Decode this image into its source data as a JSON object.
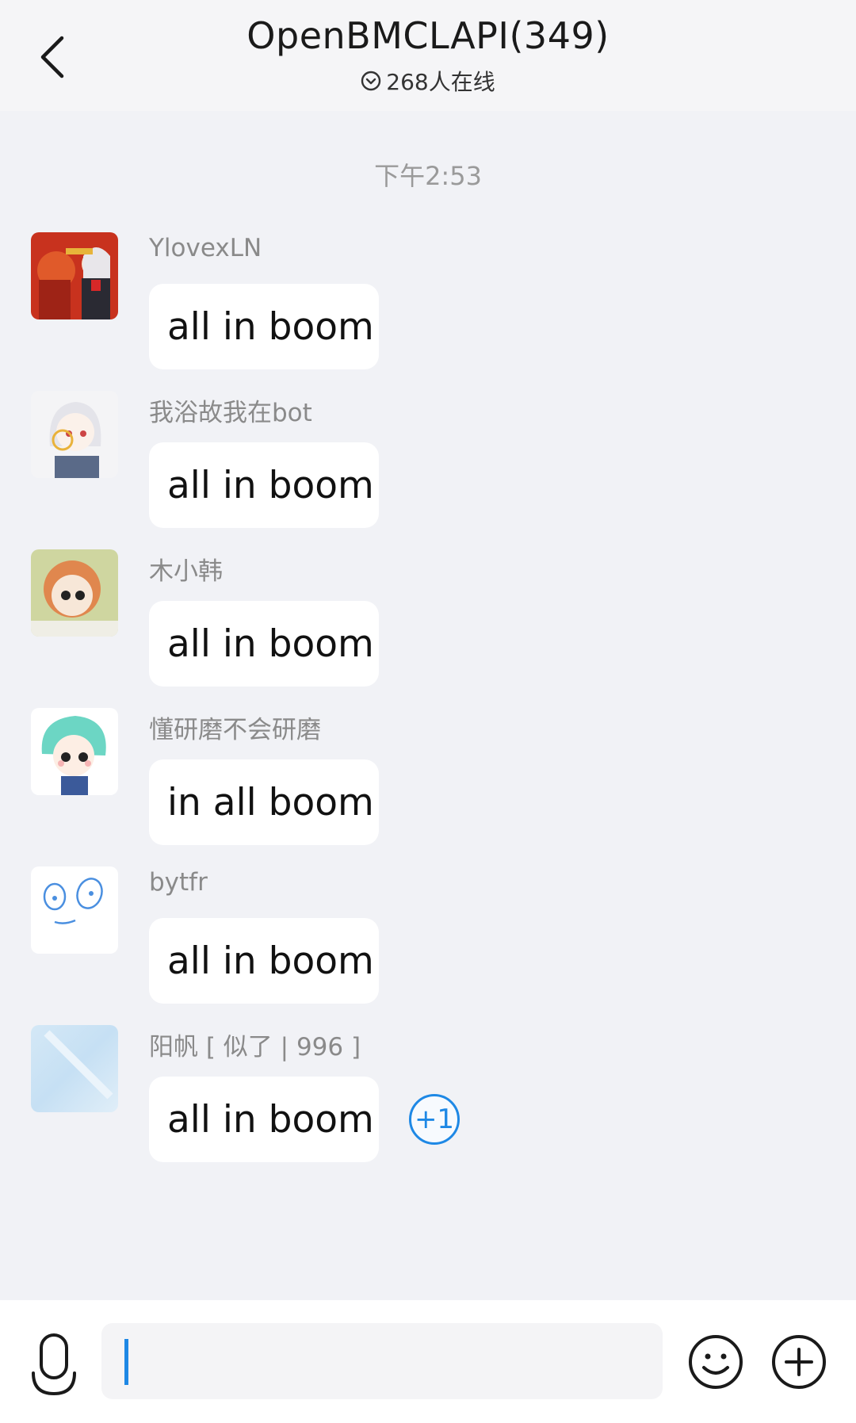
{
  "header": {
    "title": "OpenBMCLAPI(349)",
    "online_text": "268人在线"
  },
  "timestamp": "下午2:53",
  "messages": [
    {
      "sender": "YlovexLN",
      "text": "all in boom"
    },
    {
      "sender": "我浴故我在bot",
      "text": "all in boom"
    },
    {
      "sender": "木小韩",
      "text": "all in boom"
    },
    {
      "sender": "懂研磨不会研磨",
      "text": "in all boom"
    },
    {
      "sender": "bytfr",
      "text": "all in boom"
    },
    {
      "sender": "阳帆 [ 似了 | 996 ]",
      "text": "all in boom",
      "plus_one": "+1"
    }
  ],
  "input": {
    "value": "",
    "placeholder": ""
  },
  "icons": {
    "back": "chevron-left-icon",
    "online": "check-circle-icon",
    "voice": "microphone-icon",
    "emoji": "smiley-icon",
    "more": "plus-circle-icon"
  },
  "colors": {
    "accent": "#1e88e5",
    "background": "#f1f2f6",
    "bubble": "#ffffff"
  }
}
